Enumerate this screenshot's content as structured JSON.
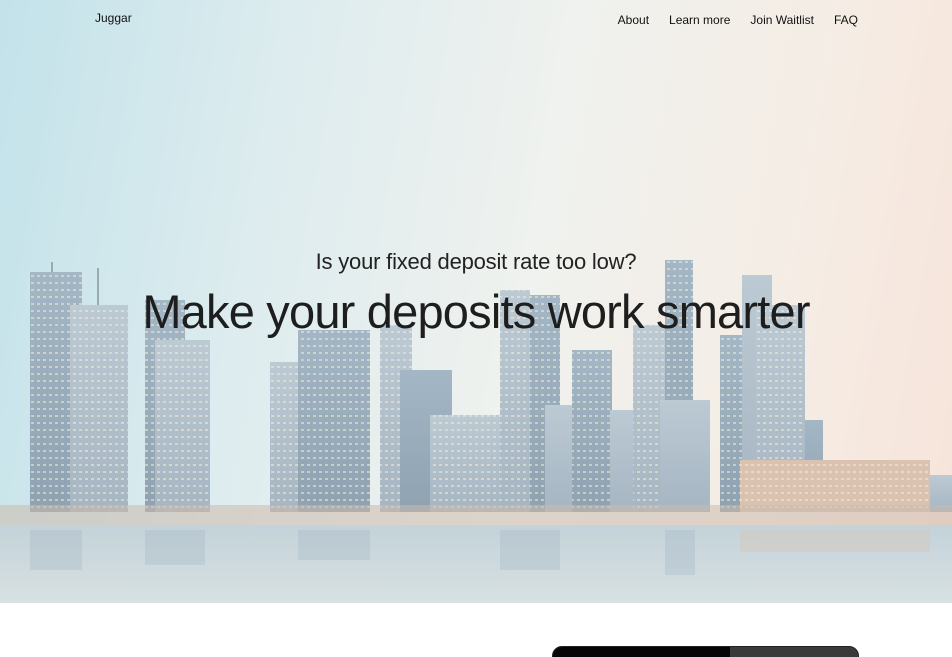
{
  "brand": {
    "name": "Juggar"
  },
  "nav": {
    "items": [
      {
        "label": "About"
      },
      {
        "label": "Learn more"
      },
      {
        "label": "Join Waitlist"
      },
      {
        "label": "FAQ"
      }
    ]
  },
  "hero": {
    "tagline": "Is your fixed deposit rate too low?",
    "headline": "Make your deposits work smarter"
  },
  "colors": {
    "text": "#111111",
    "sky_left": "#a9d6e1",
    "sky_right": "#f3d8c9",
    "water": "#b9cdd3"
  }
}
